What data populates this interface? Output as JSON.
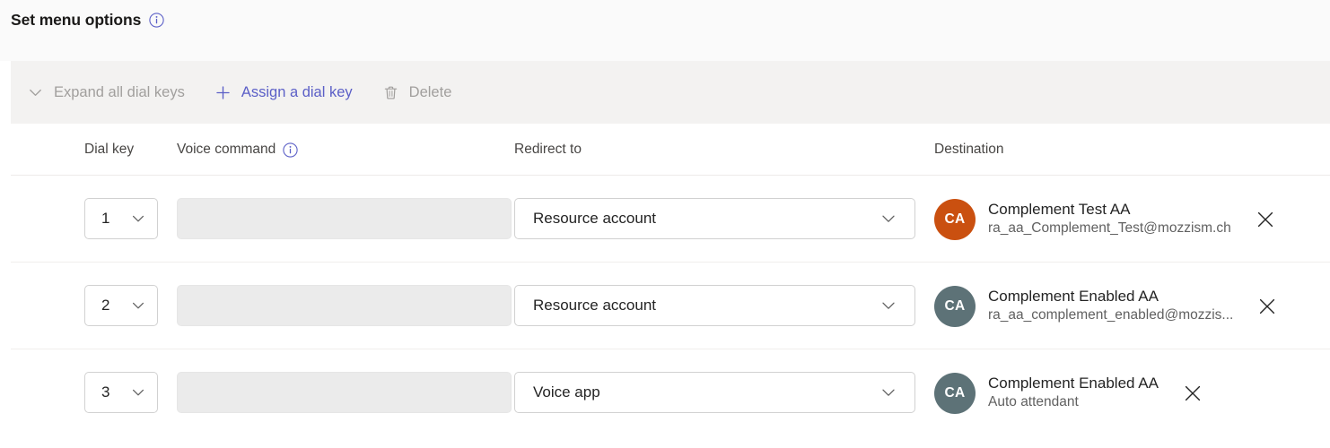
{
  "header": {
    "title": "Set menu options",
    "info_icon": "info-icon"
  },
  "toolbar": {
    "expand_label": "Expand all dial keys",
    "assign_label": "Assign a dial key",
    "delete_label": "Delete",
    "expand_icon": "chevron-down-icon",
    "assign_icon": "plus-icon",
    "delete_icon": "trash-icon",
    "link_color": "#5b5fc7",
    "disabled_color": "#a19f9d",
    "background": "#f3f2f1"
  },
  "table": {
    "columns": [
      {
        "key": "dial_key",
        "label": "Dial key"
      },
      {
        "key": "voice_command",
        "label": "Voice command",
        "info_icon": "info-icon"
      },
      {
        "key": "redirect_to",
        "label": "Redirect to"
      },
      {
        "key": "destination",
        "label": "Destination"
      }
    ],
    "rows": [
      {
        "dial_key": "1",
        "voice_command": "",
        "redirect_to": "Resource account",
        "destination": {
          "initials": "CA",
          "avatar_color": "#ca5010",
          "name": "Complement Test AA",
          "sub": "ra_aa_Complement_Test@mozzism.ch"
        },
        "remove_icon": "close-icon"
      },
      {
        "dial_key": "2",
        "voice_command": "",
        "redirect_to": "Resource account",
        "destination": {
          "initials": "CA",
          "avatar_color": "#5d7277",
          "name": "Complement Enabled AA",
          "sub": "ra_aa_complement_enabled@mozzis..."
        },
        "remove_icon": "close-icon"
      },
      {
        "dial_key": "3",
        "voice_command": "",
        "redirect_to": "Voice app",
        "destination": {
          "initials": "CA",
          "avatar_color": "#5d7277",
          "name": "Complement Enabled AA",
          "sub": "Auto attendant"
        },
        "remove_icon": "close-icon"
      }
    ]
  }
}
